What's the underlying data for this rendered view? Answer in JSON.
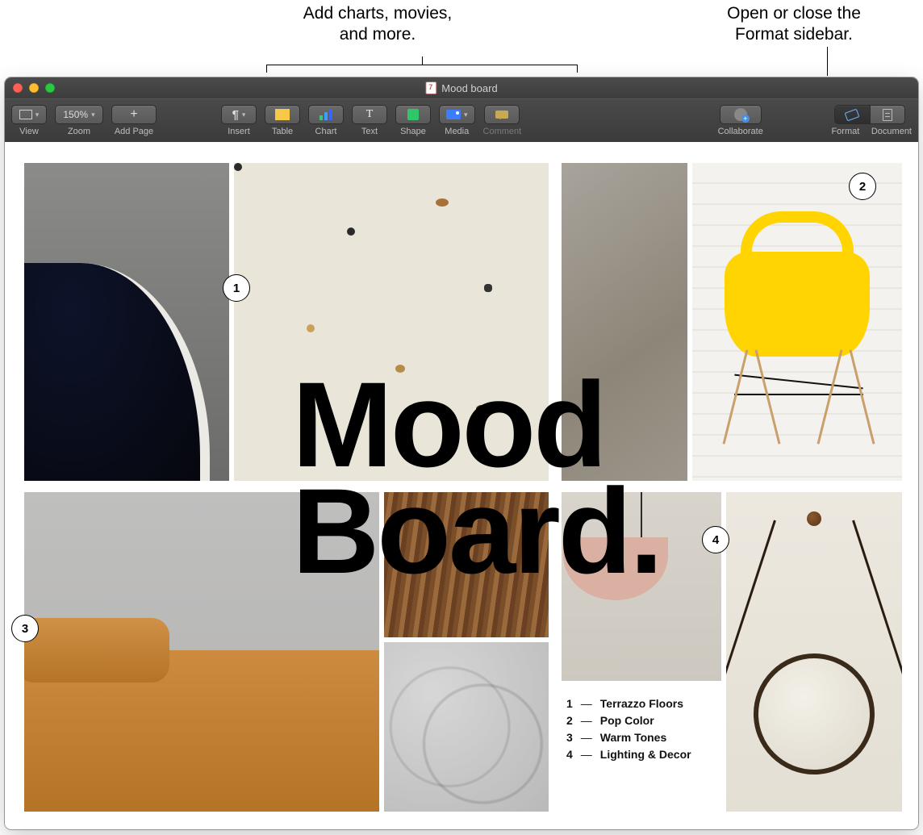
{
  "callouts": {
    "left_line1": "Add charts, movies,",
    "left_line2": "and more.",
    "right_line1": "Open or close the",
    "right_line2": "Format sidebar."
  },
  "window": {
    "title": "Mood board"
  },
  "toolbar": {
    "view": "View",
    "zoom_value": "150%",
    "zoom": "Zoom",
    "add_page": "Add Page",
    "insert": "Insert",
    "table": "Table",
    "chart": "Chart",
    "text": "Text",
    "shape": "Shape",
    "media": "Media",
    "comment": "Comment",
    "collaborate": "Collaborate",
    "format": "Format",
    "document": "Document"
  },
  "doc": {
    "headline_line1": "Mood",
    "headline_line2": "Board."
  },
  "markers": {
    "m1": "1",
    "m2": "2",
    "m3": "3",
    "m4": "4"
  },
  "legend": [
    {
      "num": "1",
      "dash": "—",
      "label": "Terrazzo Floors"
    },
    {
      "num": "2",
      "dash": "—",
      "label": "Pop Color"
    },
    {
      "num": "3",
      "dash": "—",
      "label": "Warm Tones"
    },
    {
      "num": "4",
      "dash": "—",
      "label": "Lighting & Decor"
    }
  ]
}
